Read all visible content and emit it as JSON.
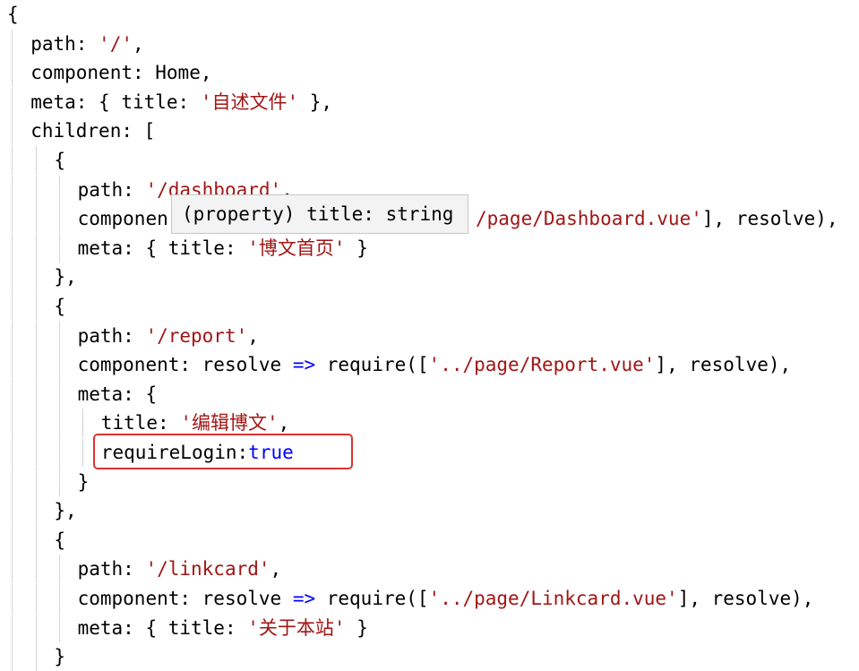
{
  "editor": {
    "language": "javascript",
    "lines": [
      [
        {
          "t": "{",
          "c": "k"
        }
      ],
      [
        {
          "t": "path: ",
          "c": "k"
        },
        {
          "t": "'/'",
          "c": "s"
        },
        {
          "t": ",",
          "c": "k"
        }
      ],
      [
        {
          "t": "component: Home,",
          "c": "k"
        }
      ],
      [
        {
          "t": "meta: { title: ",
          "c": "k"
        },
        {
          "t": "'自述文件'",
          "c": "s"
        },
        {
          "t": " },",
          "c": "k"
        }
      ],
      [
        {
          "t": "children: [",
          "c": "k"
        }
      ],
      [
        {
          "t": "{",
          "c": "k"
        }
      ],
      [
        {
          "t": "path: ",
          "c": "k"
        },
        {
          "t": "'/dashboard'",
          "c": "s"
        },
        {
          "t": ",",
          "c": "k"
        }
      ],
      [
        {
          "t": "componen",
          "c": "k"
        }
      ],
      [
        {
          "t": "meta: { title: ",
          "c": "k"
        },
        {
          "t": "'博文首页'",
          "c": "s"
        },
        {
          "t": " }",
          "c": "k"
        }
      ],
      [
        {
          "t": "},",
          "c": "k"
        }
      ],
      [
        {
          "t": "{",
          "c": "k"
        }
      ],
      [
        {
          "t": "path: ",
          "c": "k"
        },
        {
          "t": "'/report'",
          "c": "s"
        },
        {
          "t": ",",
          "c": "k"
        }
      ],
      [
        {
          "t": "component: resolve ",
          "c": "k"
        },
        {
          "t": "=>",
          "c": "b"
        },
        {
          "t": " require([",
          "c": "k"
        },
        {
          "t": "'../page/Report.vue'",
          "c": "s"
        },
        {
          "t": "], resolve),",
          "c": "k"
        }
      ],
      [
        {
          "t": "meta: {",
          "c": "k"
        }
      ],
      [
        {
          "t": "title: ",
          "c": "k"
        },
        {
          "t": "'编辑博文'",
          "c": "s"
        },
        {
          "t": ",",
          "c": "k"
        }
      ],
      [
        {
          "t": "requireLogin:",
          "c": "k"
        },
        {
          "t": "true",
          "c": "b"
        }
      ],
      [
        {
          "t": "}",
          "c": "k"
        }
      ],
      [
        {
          "t": "},",
          "c": "k"
        }
      ],
      [
        {
          "t": "{",
          "c": "k"
        }
      ],
      [
        {
          "t": "path: ",
          "c": "k"
        },
        {
          "t": "'/linkcard'",
          "c": "s"
        },
        {
          "t": ",",
          "c": "k"
        }
      ],
      [
        {
          "t": "component: resolve ",
          "c": "k"
        },
        {
          "t": "=>",
          "c": "b"
        },
        {
          "t": " require([",
          "c": "k"
        },
        {
          "t": "'../page/Linkcard.vue'",
          "c": "s"
        },
        {
          "t": "], resolve),",
          "c": "k"
        }
      ],
      [
        {
          "t": "meta: { title: ",
          "c": "k"
        },
        {
          "t": "'关于本站'",
          "c": "s"
        },
        {
          "t": " }",
          "c": "k"
        }
      ],
      [
        {
          "t": "}",
          "c": "k"
        }
      ]
    ],
    "obscured_line_tail": [
      {
        "t": "/page/Dashboard.vue'",
        "c": "s"
      },
      {
        "t": "], resolve),",
        "c": "k"
      }
    ]
  },
  "hover_tooltip": {
    "text": "(property) title: string"
  },
  "highlight_box": {
    "color": "#e03131",
    "target_line": "requireLogin:true"
  },
  "colors": {
    "default_text": "#000000",
    "string": "#a31515",
    "keyword": "#0000ff",
    "background": "#ffffff",
    "indent_guide": "#d3d3d3"
  }
}
